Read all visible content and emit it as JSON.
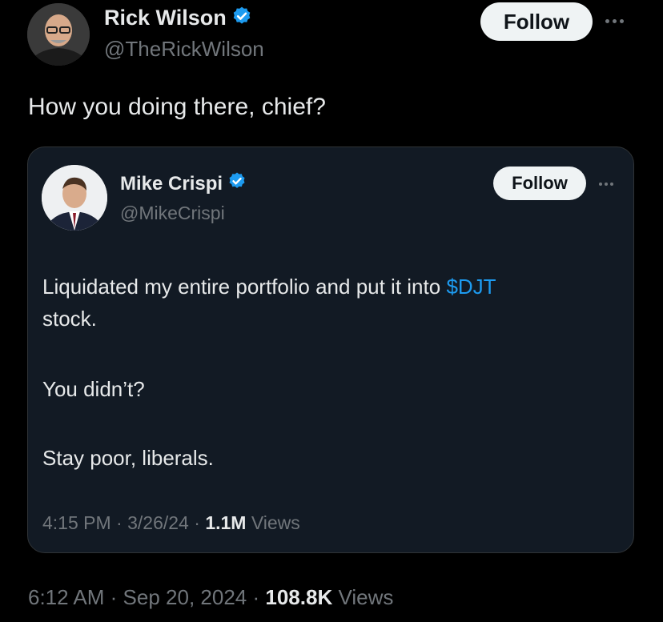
{
  "outer_tweet": {
    "author": {
      "name": "Rick Wilson",
      "handle": "@TheRickWilson",
      "verified": true
    },
    "follow_label": "Follow",
    "text": "How you doing there, chief?",
    "meta": {
      "time": "6:12 AM",
      "date": "Sep 20, 2024",
      "views_count": "108.8K",
      "views_label": "Views",
      "separator": "·"
    }
  },
  "quoted_tweet": {
    "author": {
      "name": "Mike Crispi",
      "handle": "@MikeCrispi",
      "verified": true
    },
    "follow_label": "Follow",
    "text": {
      "line1_before": "Liquidated my entire portfolio and put it into ",
      "cashtag": "$DJT",
      "line2": "stock.",
      "line3": "You didn’t?",
      "line4": "Stay poor, liberals."
    },
    "meta": {
      "time": "4:15 PM",
      "date": "3/26/24",
      "views_count": "1.1M",
      "views_label": "Views",
      "separator": "·"
    }
  },
  "colors": {
    "background": "#000000",
    "card_background": "#121a24",
    "text_primary": "#e7e9ea",
    "text_secondary": "#71767b",
    "accent_blue": "#1d9bf0",
    "button_bg": "#eff3f4"
  },
  "icons": {
    "verified": "verified-badge-icon",
    "more": "more-options-icon"
  }
}
